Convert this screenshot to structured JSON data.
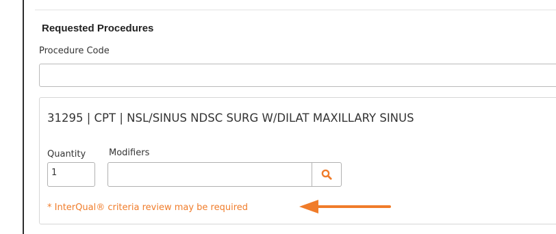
{
  "section": {
    "title": "Requested Procedures"
  },
  "procedure_code": {
    "label": "Procedure Code",
    "value": ""
  },
  "procedure": {
    "text": "31295 | CPT | NSL/SINUS NDSC SURG W/DILAT MAXILLARY SINUS"
  },
  "quantity": {
    "label": "Quantity",
    "value": "1"
  },
  "modifiers": {
    "label": "Modifiers",
    "value": "",
    "search_icon": "search-icon"
  },
  "warning": {
    "text": "* InterQual® criteria review may be required"
  },
  "colors": {
    "warning": "#f07c2a",
    "search_icon": "#f07c2a",
    "arrow": "#f07c2a"
  },
  "annotation": {
    "icon": "arrow-left-icon"
  }
}
